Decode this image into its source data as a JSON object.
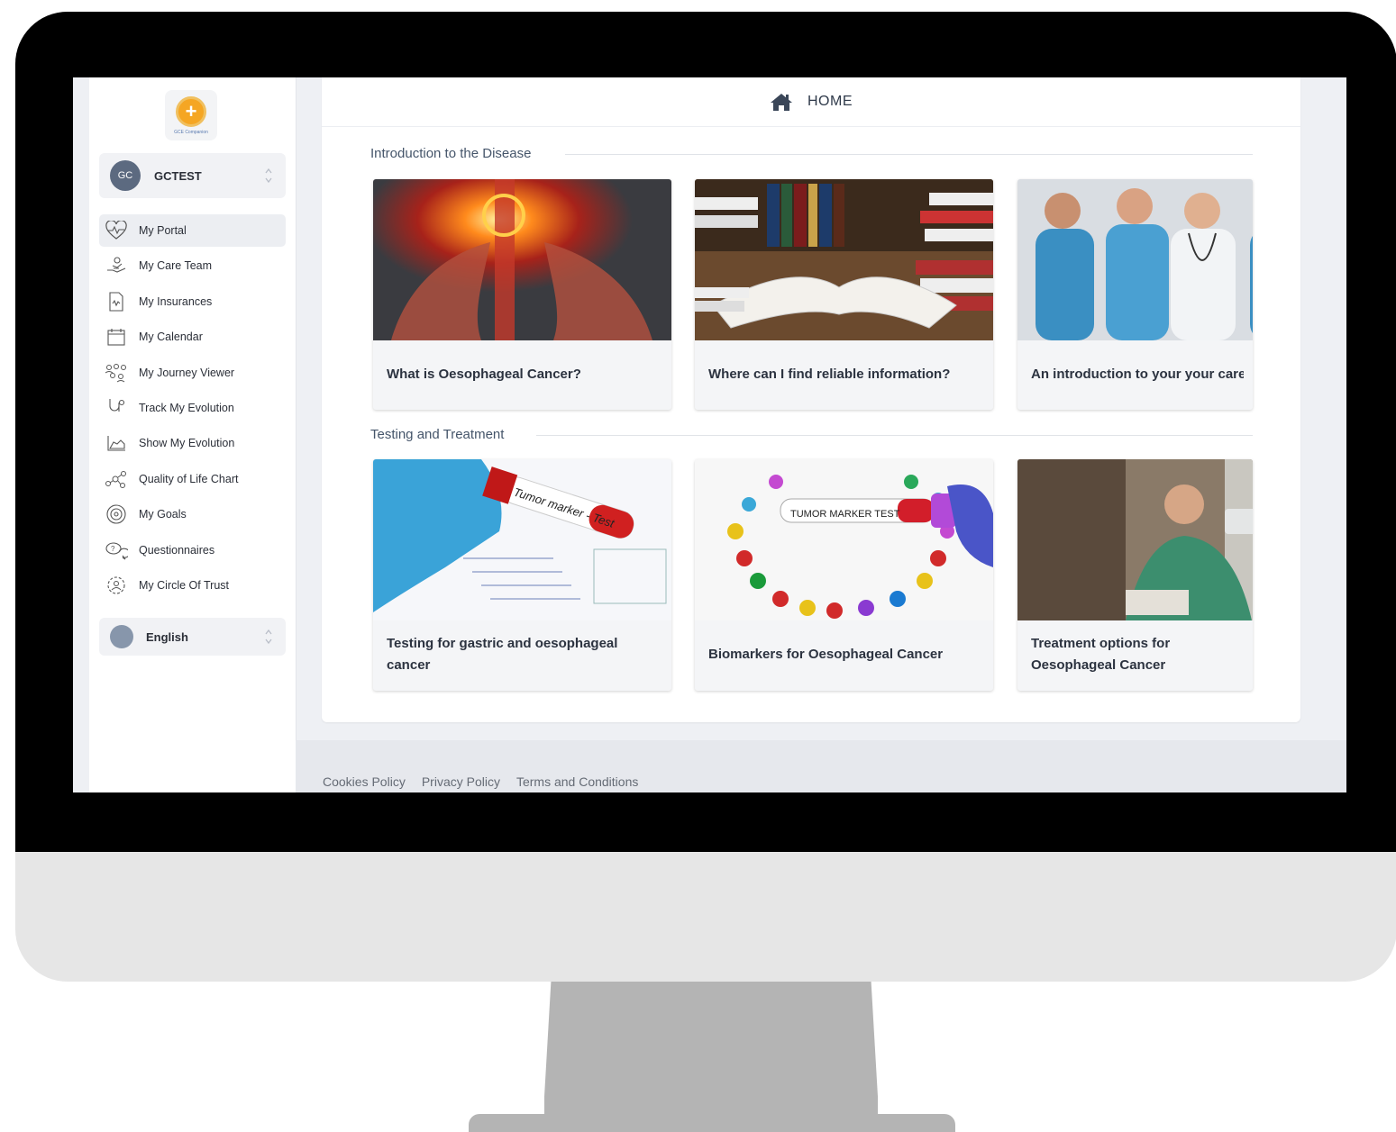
{
  "app": {
    "logo_text": "GCE Companion",
    "header": {
      "home_label": "HOME"
    }
  },
  "user": {
    "initials": "GC",
    "name": "GCTEST"
  },
  "sidebar": {
    "items": [
      {
        "label": "My Portal",
        "icon": "heart-pulse-icon"
      },
      {
        "label": "My Care Team",
        "icon": "care-hand-icon"
      },
      {
        "label": "My Insurances",
        "icon": "insurance-document-icon"
      },
      {
        "label": "My Calendar",
        "icon": "calendar-icon"
      },
      {
        "label": "My Journey Viewer",
        "icon": "people-journey-icon"
      },
      {
        "label": "Track My Evolution",
        "icon": "stethoscope-icon"
      },
      {
        "label": "Show My Evolution",
        "icon": "area-chart-icon"
      },
      {
        "label": "Quality of Life Chart",
        "icon": "network-nodes-icon"
      },
      {
        "label": "My Goals",
        "icon": "target-icon"
      },
      {
        "label": "Questionnaires",
        "icon": "chat-bubbles-icon"
      },
      {
        "label": "My Circle Of Trust",
        "icon": "circle-people-icon"
      }
    ],
    "language": "English"
  },
  "sections": [
    {
      "title": "Introduction to the Disease",
      "cards": [
        {
          "title": "What is Oesophageal Cancer?"
        },
        {
          "title": "Where can I find reliable information?"
        },
        {
          "title": "An introduction to your your care"
        }
      ]
    },
    {
      "title": "Testing and Treatment",
      "cards": [
        {
          "title": "Testing for gastric and oesophageal cancer"
        },
        {
          "title": "Biomarkers for Oesophageal Cancer",
          "image_text": "TUMOR MARKER TEST"
        },
        {
          "title": "Treatment options for Oesophageal Cancer"
        }
      ]
    }
  ],
  "image_labels": {
    "tumor_marker_tube": "Tumor marker - Test"
  },
  "footer": {
    "links": [
      "Cookies Policy",
      "Privacy Policy",
      "Terms and Conditions"
    ]
  },
  "colors": {
    "accent": "#f5a623",
    "active_nav_bg": "#eceef2",
    "text_dark": "#2b2f38"
  }
}
